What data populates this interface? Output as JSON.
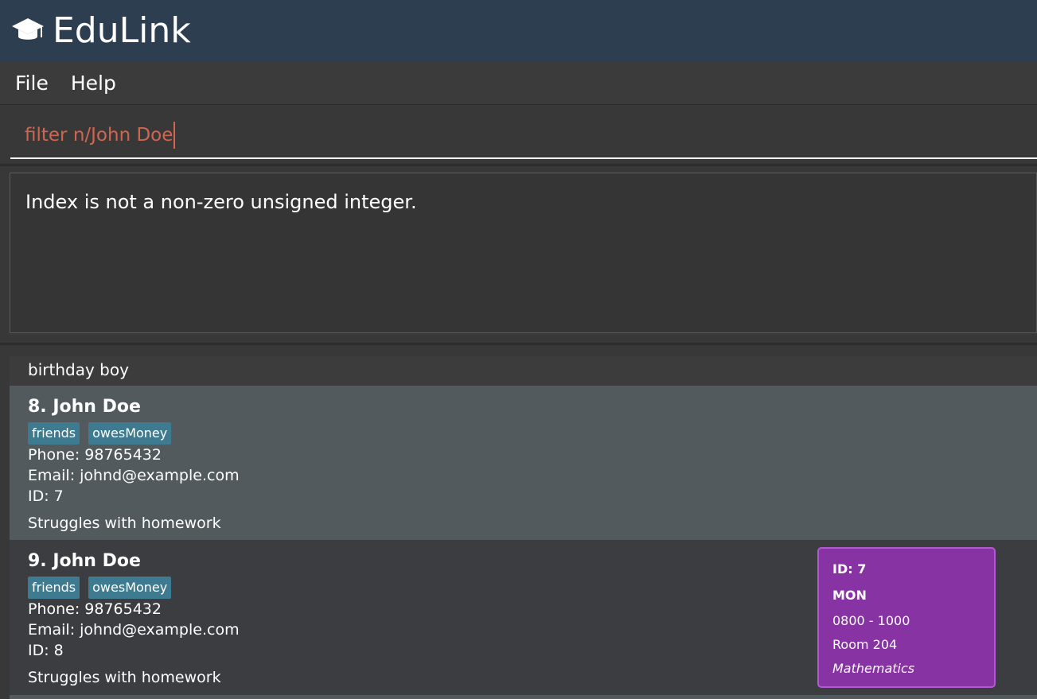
{
  "app": {
    "title": "EduLink",
    "icon": "graduation-cap-icon"
  },
  "menu": {
    "items": [
      {
        "label": "File"
      },
      {
        "label": "Help"
      }
    ]
  },
  "command": {
    "value": "filter n/John Doe",
    "error_color": "#d06651"
  },
  "result": {
    "message": "Index is not a non-zero unsigned integer."
  },
  "list": {
    "header": "birthday boy",
    "cards": [
      {
        "name": "8. John Doe",
        "tags": [
          "friends",
          "owesMoney"
        ],
        "phone_label": "Phone:",
        "phone": "98765432",
        "email_label": "Email:",
        "email": "johnd@example.com",
        "id_label": "ID:",
        "id": "7",
        "remark": "Struggles with homework"
      },
      {
        "name": "9. John Doe",
        "tags": [
          "friends",
          "owesMoney"
        ],
        "phone_label": "Phone:",
        "phone": "98765432",
        "email_label": "Email:",
        "email": "johnd@example.com",
        "id_label": "ID:",
        "id": "8",
        "remark": "Struggles with homework"
      }
    ]
  },
  "lesson": {
    "id": "ID: 7",
    "day": "MON",
    "time": "0800 - 1000",
    "room": "Room 204",
    "subject": "Mathematics",
    "color": "#8833a3"
  }
}
